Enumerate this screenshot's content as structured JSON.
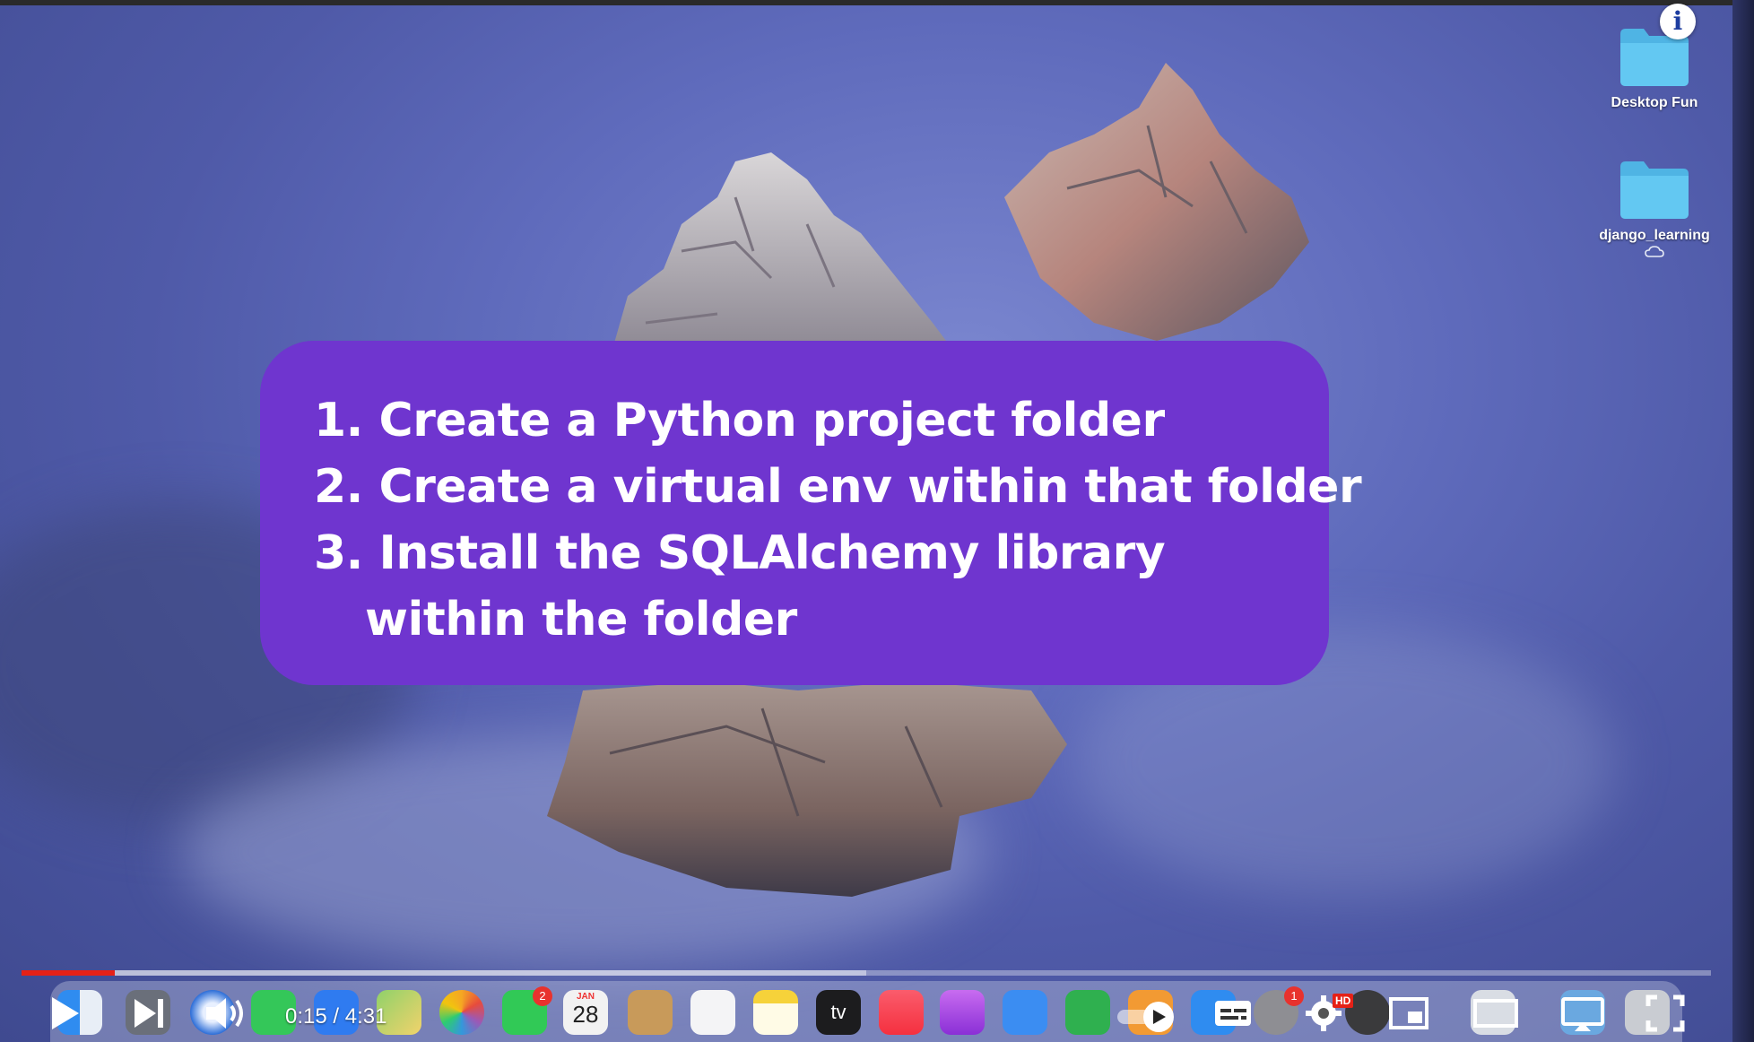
{
  "desktop": {
    "items": [
      {
        "label": "Desktop Fun"
      },
      {
        "label": "django_learning"
      }
    ]
  },
  "slide": {
    "lines": [
      "1. Create a Python project folder",
      "2. Create a virtual env within that folder",
      "3. Install the SQLAlchemy library",
      "within the folder"
    ]
  },
  "player": {
    "time_display": "0:15 / 4:31",
    "played_fraction": 0.0554,
    "loaded_fraction": 0.5,
    "hd_label": "HD",
    "info_label": "i"
  },
  "dock": {
    "calendar_month": "JAN",
    "calendar_day": "28",
    "facetime_badge": "2",
    "settings_badge": "1",
    "tv_label": "tv"
  },
  "colors": {
    "callout": "#6f35cf",
    "progress_played": "#e62117",
    "folder": "#5ec8f0"
  }
}
